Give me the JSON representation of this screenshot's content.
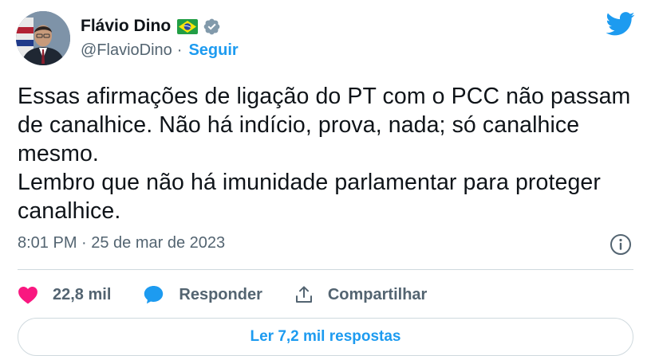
{
  "author": {
    "name": "Flávio Dino",
    "handle": "@FlavioDino",
    "separator": "·",
    "follow_label": "Seguir"
  },
  "icons": {
    "avatar": "author-photo",
    "flag": "brazil-flag-icon",
    "verified": "verified-badge-icon",
    "logo": "twitter-bird-icon",
    "info": "info-icon",
    "like": "heart-icon",
    "reply": "speech-bubble-icon",
    "share": "share-upload-icon"
  },
  "tweet": {
    "text": "Essas afirmações de ligação do PT com o PCC não passam de canalhice. Não há indício, prova, nada; só canalhice mesmo.\nLembro que não há imunidade parlamentar para proteger canalhice.",
    "timestamp": "8:01 PM · 25 de mar de 2023"
  },
  "actions": {
    "likes_count": "22,8 mil",
    "reply_label": "Responder",
    "share_label": "Compartilhar"
  },
  "replies_button": "Ler 7,2 mil respostas",
  "colors": {
    "accent": "#1d9bf0",
    "like": "#f91880",
    "text": "#0f1419",
    "muted": "#536471",
    "border": "#cfd9de"
  }
}
